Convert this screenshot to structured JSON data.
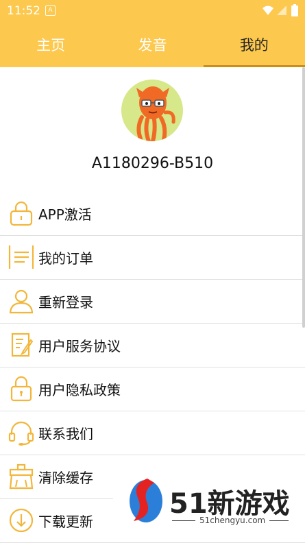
{
  "status": {
    "time": "11:52",
    "notif": "A"
  },
  "tabs": [
    {
      "label": "主页"
    },
    {
      "label": "发音"
    },
    {
      "label": "我的"
    }
  ],
  "profile": {
    "user_id": "A1180296-B510"
  },
  "menu": [
    {
      "label": "APP激活",
      "icon": "lock-icon"
    },
    {
      "label": "我的订单",
      "icon": "list-icon"
    },
    {
      "label": "重新登录",
      "icon": "user-icon"
    },
    {
      "label": "用户服务协议",
      "icon": "document-icon"
    },
    {
      "label": "用户隐私政策",
      "icon": "lock-icon"
    },
    {
      "label": "联系我们",
      "icon": "headset-icon"
    },
    {
      "label": "清除缓存",
      "icon": "broom-icon"
    },
    {
      "label": "下载更新",
      "icon": "download-icon"
    }
  ],
  "watermark": {
    "brand": "51新游戏",
    "url": "51chengyu.com"
  },
  "colors": {
    "accent": "#fcc84d",
    "icon": "#f2b63a",
    "active_tab_line": "#c98f18"
  }
}
